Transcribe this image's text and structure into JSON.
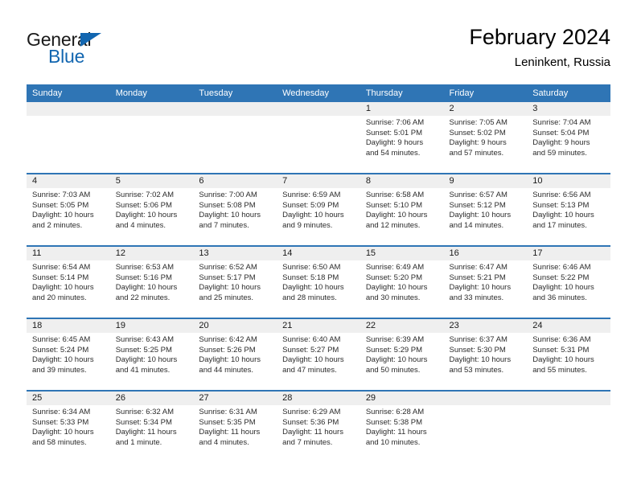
{
  "brand": {
    "word_one": "General",
    "word_two": "Blue",
    "triangle_icon": "triangle-icon",
    "color_dark": "#1a1a1a",
    "color_blue": "#1266b0"
  },
  "header": {
    "title": "February 2024",
    "subtitle": "Leninkent, Russia"
  },
  "theme": {
    "header_blue": "#2f75b5",
    "daynum_band": "#efefef",
    "text": "#2b2b2b"
  },
  "weekday_headers": [
    "Sunday",
    "Monday",
    "Tuesday",
    "Wednesday",
    "Thursday",
    "Friday",
    "Saturday"
  ],
  "weeks": [
    [
      {
        "day": "",
        "lines": []
      },
      {
        "day": "",
        "lines": []
      },
      {
        "day": "",
        "lines": []
      },
      {
        "day": "",
        "lines": []
      },
      {
        "day": "1",
        "lines": [
          "Sunrise: 7:06 AM",
          "Sunset: 5:01 PM",
          "Daylight: 9 hours",
          "and 54 minutes."
        ]
      },
      {
        "day": "2",
        "lines": [
          "Sunrise: 7:05 AM",
          "Sunset: 5:02 PM",
          "Daylight: 9 hours",
          "and 57 minutes."
        ]
      },
      {
        "day": "3",
        "lines": [
          "Sunrise: 7:04 AM",
          "Sunset: 5:04 PM",
          "Daylight: 9 hours",
          "and 59 minutes."
        ]
      }
    ],
    [
      {
        "day": "4",
        "lines": [
          "Sunrise: 7:03 AM",
          "Sunset: 5:05 PM",
          "Daylight: 10 hours",
          "and 2 minutes."
        ]
      },
      {
        "day": "5",
        "lines": [
          "Sunrise: 7:02 AM",
          "Sunset: 5:06 PM",
          "Daylight: 10 hours",
          "and 4 minutes."
        ]
      },
      {
        "day": "6",
        "lines": [
          "Sunrise: 7:00 AM",
          "Sunset: 5:08 PM",
          "Daylight: 10 hours",
          "and 7 minutes."
        ]
      },
      {
        "day": "7",
        "lines": [
          "Sunrise: 6:59 AM",
          "Sunset: 5:09 PM",
          "Daylight: 10 hours",
          "and 9 minutes."
        ]
      },
      {
        "day": "8",
        "lines": [
          "Sunrise: 6:58 AM",
          "Sunset: 5:10 PM",
          "Daylight: 10 hours",
          "and 12 minutes."
        ]
      },
      {
        "day": "9",
        "lines": [
          "Sunrise: 6:57 AM",
          "Sunset: 5:12 PM",
          "Daylight: 10 hours",
          "and 14 minutes."
        ]
      },
      {
        "day": "10",
        "lines": [
          "Sunrise: 6:56 AM",
          "Sunset: 5:13 PM",
          "Daylight: 10 hours",
          "and 17 minutes."
        ]
      }
    ],
    [
      {
        "day": "11",
        "lines": [
          "Sunrise: 6:54 AM",
          "Sunset: 5:14 PM",
          "Daylight: 10 hours",
          "and 20 minutes."
        ]
      },
      {
        "day": "12",
        "lines": [
          "Sunrise: 6:53 AM",
          "Sunset: 5:16 PM",
          "Daylight: 10 hours",
          "and 22 minutes."
        ]
      },
      {
        "day": "13",
        "lines": [
          "Sunrise: 6:52 AM",
          "Sunset: 5:17 PM",
          "Daylight: 10 hours",
          "and 25 minutes."
        ]
      },
      {
        "day": "14",
        "lines": [
          "Sunrise: 6:50 AM",
          "Sunset: 5:18 PM",
          "Daylight: 10 hours",
          "and 28 minutes."
        ]
      },
      {
        "day": "15",
        "lines": [
          "Sunrise: 6:49 AM",
          "Sunset: 5:20 PM",
          "Daylight: 10 hours",
          "and 30 minutes."
        ]
      },
      {
        "day": "16",
        "lines": [
          "Sunrise: 6:47 AM",
          "Sunset: 5:21 PM",
          "Daylight: 10 hours",
          "and 33 minutes."
        ]
      },
      {
        "day": "17",
        "lines": [
          "Sunrise: 6:46 AM",
          "Sunset: 5:22 PM",
          "Daylight: 10 hours",
          "and 36 minutes."
        ]
      }
    ],
    [
      {
        "day": "18",
        "lines": [
          "Sunrise: 6:45 AM",
          "Sunset: 5:24 PM",
          "Daylight: 10 hours",
          "and 39 minutes."
        ]
      },
      {
        "day": "19",
        "lines": [
          "Sunrise: 6:43 AM",
          "Sunset: 5:25 PM",
          "Daylight: 10 hours",
          "and 41 minutes."
        ]
      },
      {
        "day": "20",
        "lines": [
          "Sunrise: 6:42 AM",
          "Sunset: 5:26 PM",
          "Daylight: 10 hours",
          "and 44 minutes."
        ]
      },
      {
        "day": "21",
        "lines": [
          "Sunrise: 6:40 AM",
          "Sunset: 5:27 PM",
          "Daylight: 10 hours",
          "and 47 minutes."
        ]
      },
      {
        "day": "22",
        "lines": [
          "Sunrise: 6:39 AM",
          "Sunset: 5:29 PM",
          "Daylight: 10 hours",
          "and 50 minutes."
        ]
      },
      {
        "day": "23",
        "lines": [
          "Sunrise: 6:37 AM",
          "Sunset: 5:30 PM",
          "Daylight: 10 hours",
          "and 53 minutes."
        ]
      },
      {
        "day": "24",
        "lines": [
          "Sunrise: 6:36 AM",
          "Sunset: 5:31 PM",
          "Daylight: 10 hours",
          "and 55 minutes."
        ]
      }
    ],
    [
      {
        "day": "25",
        "lines": [
          "Sunrise: 6:34 AM",
          "Sunset: 5:33 PM",
          "Daylight: 10 hours",
          "and 58 minutes."
        ]
      },
      {
        "day": "26",
        "lines": [
          "Sunrise: 6:32 AM",
          "Sunset: 5:34 PM",
          "Daylight: 11 hours",
          "and 1 minute."
        ]
      },
      {
        "day": "27",
        "lines": [
          "Sunrise: 6:31 AM",
          "Sunset: 5:35 PM",
          "Daylight: 11 hours",
          "and 4 minutes."
        ]
      },
      {
        "day": "28",
        "lines": [
          "Sunrise: 6:29 AM",
          "Sunset: 5:36 PM",
          "Daylight: 11 hours",
          "and 7 minutes."
        ]
      },
      {
        "day": "29",
        "lines": [
          "Sunrise: 6:28 AM",
          "Sunset: 5:38 PM",
          "Daylight: 11 hours",
          "and 10 minutes."
        ]
      },
      {
        "day": "",
        "lines": []
      },
      {
        "day": "",
        "lines": []
      }
    ]
  ]
}
